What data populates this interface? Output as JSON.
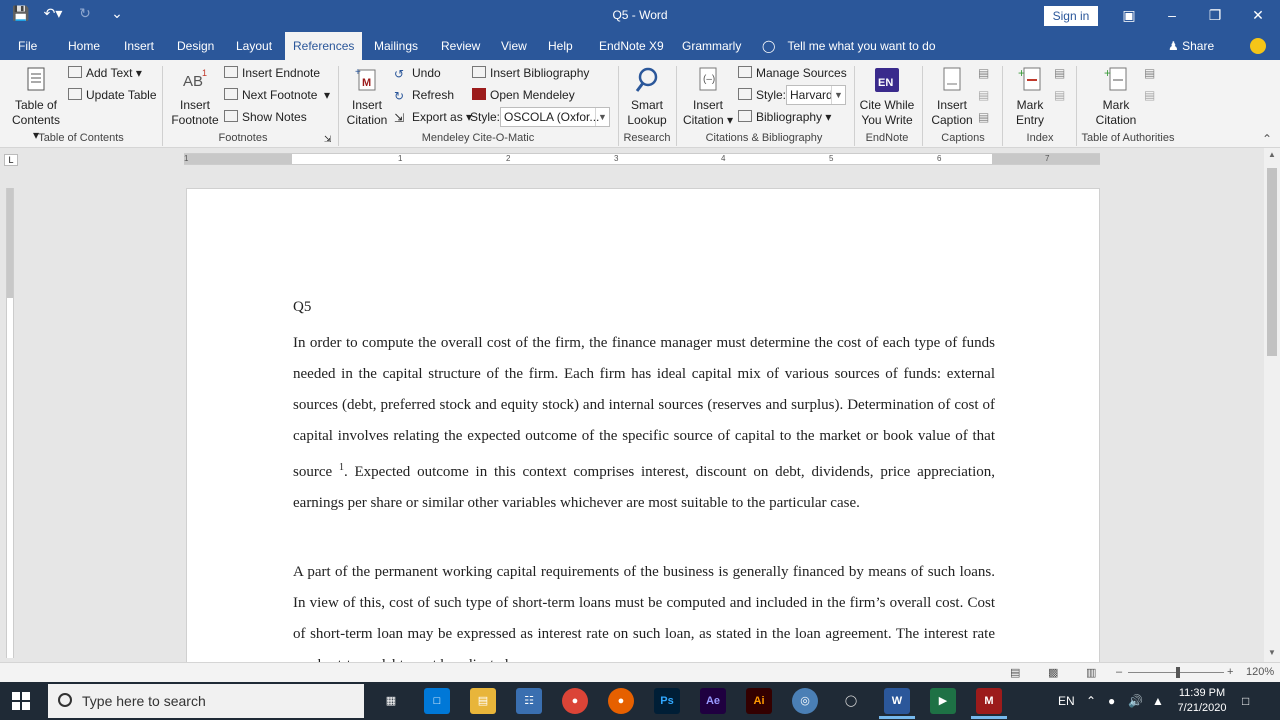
{
  "window": {
    "title": "Q5  -  Word",
    "signin_label": "Sign in"
  },
  "tabs": [
    {
      "label": "File"
    },
    {
      "label": "Home"
    },
    {
      "label": "Insert"
    },
    {
      "label": "Design"
    },
    {
      "label": "Layout"
    },
    {
      "label": "References"
    },
    {
      "label": "Mailings"
    },
    {
      "label": "Review"
    },
    {
      "label": "View"
    },
    {
      "label": "Help"
    },
    {
      "label": "EndNote X9"
    },
    {
      "label": "Grammarly"
    }
  ],
  "tell_me": "Tell me what you want to do",
  "share_label": "Share",
  "ribbon": {
    "toc": {
      "big": "Table of Contents",
      "add_text": "Add Text",
      "update_table": "Update Table",
      "group": "Table of Contents"
    },
    "footnotes": {
      "big": "Insert Footnote",
      "insert_endnote": "Insert Endnote",
      "next_footnote": "Next Footnote",
      "show_notes": "Show Notes",
      "group": "Footnotes"
    },
    "mendeley": {
      "big": "Insert Citation",
      "undo": "Undo",
      "refresh": "Refresh",
      "export_as": "Export as",
      "insert_bibliography": "Insert Bibliography",
      "open_mendeley": "Open Mendeley",
      "style_label": "Style:",
      "style_value": "OSCOLA (Oxfor...",
      "group": "Mendeley Cite-O-Matic"
    },
    "research": {
      "big": "Smart Lookup",
      "group": "Research"
    },
    "citations": {
      "big": "Insert Citation",
      "manage_sources": "Manage Sources",
      "style_label": "Style:",
      "style_value": "Harvard",
      "bibliography": "Bibliography",
      "group": "Citations & Bibliography"
    },
    "endnote": {
      "big": "Cite While You Write",
      "group": "EndNote"
    },
    "captions": {
      "big": "Insert Caption",
      "group": "Captions"
    },
    "index": {
      "big": "Mark Entry",
      "group": "Index"
    },
    "authorities": {
      "big": "Mark Citation",
      "group": "Table of Authorities"
    }
  },
  "ruler_numbers": [
    "1",
    "1",
    "2",
    "3",
    "4",
    "5",
    "6",
    "7"
  ],
  "document": {
    "heading": "Q5",
    "p1_before_sup": "In order to compute the overall cost of the firm, the finance manager must determine the cost of each type of funds needed in the capital structure of the firm. Each firm has ideal capital mix of various sources of funds: external sources (debt, preferred stock and equity stock) and internal sources (reserves and surplus). Determination of cost of capital involves relating the expected outcome of the specific source of capital to the market or book value of that source ",
    "p1_sup": "1",
    "p1_after_sup": ". Expected outcome in this context comprises interest, discount on debt, dividends, price appreciation, earnings per share or similar other variables whichever are most suitable to the particular case.",
    "p2": "A part of the permanent working capital requirements of the business is generally financed by means of such loans. In view of this, cost of such type of short-term loans must be computed and included in the firm’s overall cost. Cost of short-term loan may be expressed as interest rate on such loan, as stated in the loan agreement. The interest rate on short-term debt must be adjusted"
  },
  "status": {
    "zoom": "120%"
  },
  "taskbar": {
    "search_placeholder": "Type here to search",
    "lang": "EN",
    "time": "11:39 PM",
    "date": "7/21/2020"
  },
  "colors": {
    "word_blue": "#2b579a",
    "taskbar": "#1f2a36"
  }
}
